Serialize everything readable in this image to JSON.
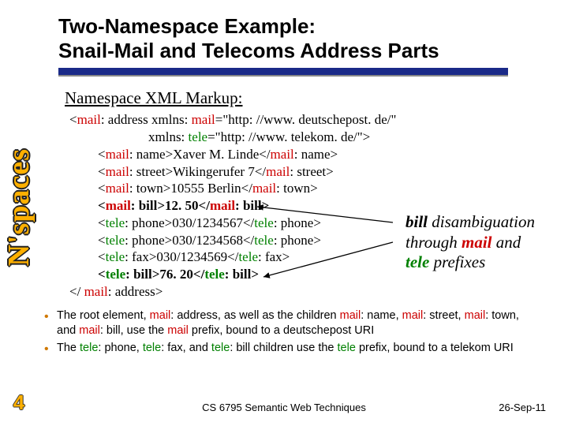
{
  "title_line1": "Two-Namespace Example:",
  "title_line2": "Snail-Mail and Telecoms Address Parts",
  "vertical_label": "N'spaces",
  "subheading": "Namespace XML Markup:",
  "code": {
    "l1a": "<",
    "l1b": "mail",
    "l1c": ": address xmlns: ",
    "l1d": "mail",
    "l1e": "=\"http: //www. deutschepost. de/\"",
    "l2a": "xmlns: ",
    "l2b": "tele",
    "l2c": "=\"http: //www. telekom. de/\">",
    "l3a": "<",
    "l3b": "mail",
    "l3c": ": name>Xaver M. Linde</",
    "l3d": "mail",
    "l3e": ": name>",
    "l4a": "<",
    "l4b": "mail",
    "l4c": ": street>Wikingerufer 7</",
    "l4d": "mail",
    "l4e": ": street>",
    "l5a": "<",
    "l5b": "mail",
    "l5c": ": town>10555 Berlin</",
    "l5d": "mail",
    "l5e": ": town>",
    "l6a": "<",
    "l6b": "mail",
    "l6c": ": bill>12. 50</",
    "l6d": "mail",
    "l6e": ": bill>",
    "l7a": "<",
    "l7b": "tele",
    "l7c": ": phone>030/1234567</",
    "l7d": "tele",
    "l7e": ": phone>",
    "l8a": "<",
    "l8b": "tele",
    "l8c": ": phone>030/1234568</",
    "l8d": "tele",
    "l8e": ": phone>",
    "l9a": "<",
    "l9b": "tele",
    "l9c": ": fax>030/1234569</",
    "l9d": "tele",
    "l9e": ": fax>",
    "l10a": "<",
    "l10b": "tele",
    "l10c": ": bill>76. 20</",
    "l10d": "tele",
    "l10e": ": bill>",
    "l11a": "</ ",
    "l11b": "mail",
    "l11c": ": address>"
  },
  "callout": {
    "w1": "bill",
    "w2": " disambiguation",
    "w3": "through ",
    "w4": "mail",
    "w5": " and",
    "w6": "tele",
    "w7": " prefixes"
  },
  "bullets": {
    "b1a": "The root element, ",
    "b1b": "mail",
    "b1c": ": address, as well as the children ",
    "b1d": "mail",
    "b1e": ": name, ",
    "b1f": "mail",
    "b1g": ": street, ",
    "b1h": "mail",
    "b1i": ": town, and ",
    "b1j": "mail",
    "b1k": ": bill, use the ",
    "b1l": "mail",
    "b1m": " prefix, bound to a deutschepost URI",
    "b2a": "The ",
    "b2b": "tele",
    "b2c": ": phone, ",
    "b2d": "tele",
    "b2e": ": fax, and ",
    "b2f": "tele",
    "b2g": ": bill children use the ",
    "b2h": "tele",
    "b2i": " prefix, bound to a telekom URI"
  },
  "slide_number": "4",
  "footer_center": "CS 6795 Semantic Web Techniques",
  "footer_date": "26-Sep-11"
}
